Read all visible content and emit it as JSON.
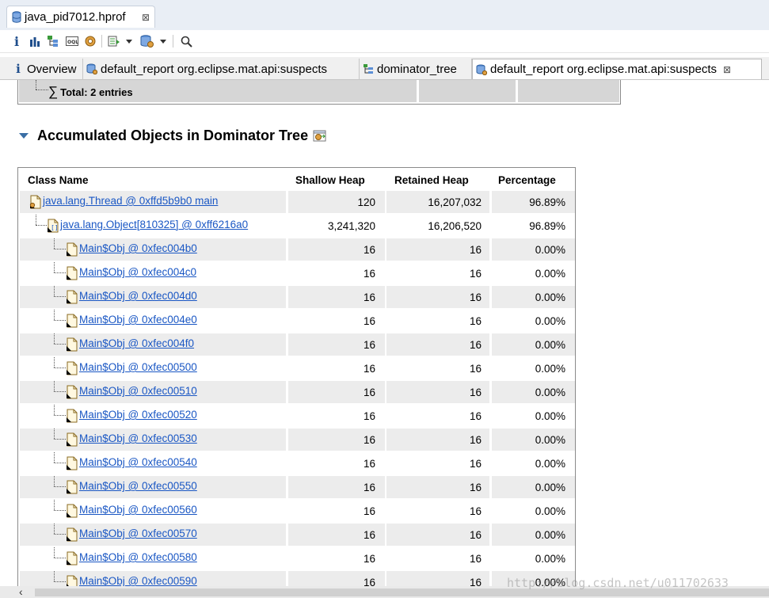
{
  "editor": {
    "file_tab_title": "java_pid7012.hprof",
    "close_glyph": "⊠"
  },
  "toolbar": {
    "info_glyph": "i"
  },
  "report_tabs": [
    {
      "label": "Overview",
      "icon": "info-icon",
      "glyph": "i"
    },
    {
      "label": "default_report  org.eclipse.mat.api:suspects",
      "icon": "report-icon"
    },
    {
      "label": "dominator_tree",
      "icon": "tree-icon"
    },
    {
      "label": "default_report  org.eclipse.mat.api:suspects",
      "icon": "report-icon",
      "active": true
    }
  ],
  "total_row": {
    "sigma": "∑",
    "label": "Total: 2 entries"
  },
  "section": {
    "title": "Accumulated Objects in Dominator Tree"
  },
  "table": {
    "columns": [
      "Class Name",
      "Shallow Heap",
      "Retained Heap",
      "Percentage"
    ],
    "rows": [
      {
        "name": "java.lang.Thread @ 0xffd5b9b0 main",
        "shallow": "120",
        "retained": "16,207,032",
        "percent": "96.89%"
      },
      {
        "name": "java.lang.Object[810325] @ 0xff6216a0",
        "shallow": "3,241,320",
        "retained": "16,206,520",
        "percent": "96.89%"
      },
      {
        "name": "Main$Obj @ 0xfec004b0",
        "shallow": "16",
        "retained": "16",
        "percent": "0.00%"
      },
      {
        "name": "Main$Obj @ 0xfec004c0",
        "shallow": "16",
        "retained": "16",
        "percent": "0.00%"
      },
      {
        "name": "Main$Obj @ 0xfec004d0",
        "shallow": "16",
        "retained": "16",
        "percent": "0.00%"
      },
      {
        "name": "Main$Obj @ 0xfec004e0",
        "shallow": "16",
        "retained": "16",
        "percent": "0.00%"
      },
      {
        "name": "Main$Obj @ 0xfec004f0",
        "shallow": "16",
        "retained": "16",
        "percent": "0.00%"
      },
      {
        "name": "Main$Obj @ 0xfec00500",
        "shallow": "16",
        "retained": "16",
        "percent": "0.00%"
      },
      {
        "name": "Main$Obj @ 0xfec00510",
        "shallow": "16",
        "retained": "16",
        "percent": "0.00%"
      },
      {
        "name": "Main$Obj @ 0xfec00520",
        "shallow": "16",
        "retained": "16",
        "percent": "0.00%"
      },
      {
        "name": "Main$Obj @ 0xfec00530",
        "shallow": "16",
        "retained": "16",
        "percent": "0.00%"
      },
      {
        "name": "Main$Obj @ 0xfec00540",
        "shallow": "16",
        "retained": "16",
        "percent": "0.00%"
      },
      {
        "name": "Main$Obj @ 0xfec00550",
        "shallow": "16",
        "retained": "16",
        "percent": "0.00%"
      },
      {
        "name": "Main$Obj @ 0xfec00560",
        "shallow": "16",
        "retained": "16",
        "percent": "0.00%"
      },
      {
        "name": "Main$Obj @ 0xfec00570",
        "shallow": "16",
        "retained": "16",
        "percent": "0.00%"
      },
      {
        "name": "Main$Obj @ 0xfec00580",
        "shallow": "16",
        "retained": "16",
        "percent": "0.00%"
      },
      {
        "name": "Main$Obj @ 0xfec00590",
        "shallow": "16",
        "retained": "16",
        "percent": "0.00%"
      }
    ]
  },
  "scrollbar": {
    "left_arrow": "‹"
  },
  "watermark": "http://blog.csdn.net/u011702633",
  "colors": {
    "link": "#1a57c4",
    "row_shade": "#ececec",
    "accent": "#3a6ea5"
  }
}
